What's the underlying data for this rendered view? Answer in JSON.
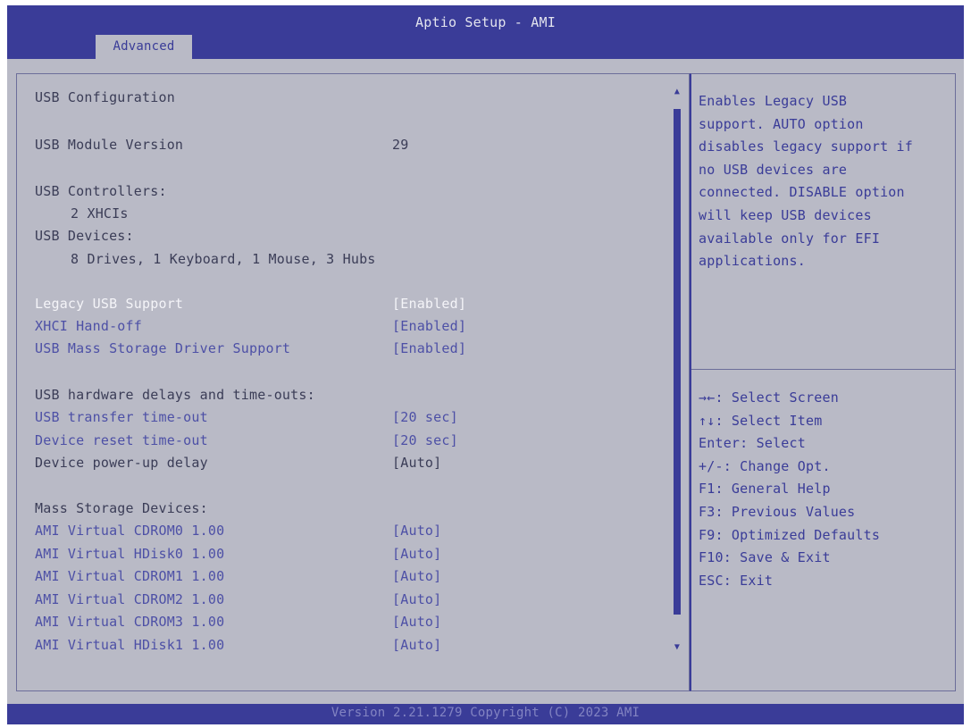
{
  "header": {
    "title": "Aptio Setup - AMI",
    "tab": "Advanced"
  },
  "main": {
    "section_title": "USB Configuration",
    "module_version": {
      "label": "USB Module Version",
      "value": "29"
    },
    "controllers_label": "USB Controllers:",
    "controllers_value": "2 XHCIs",
    "devices_label": "USB Devices:",
    "devices_value": "8 Drives, 1 Keyboard, 1 Mouse, 3 Hubs",
    "options": [
      {
        "label": "Legacy USB Support",
        "value": "[Enabled]"
      },
      {
        "label": "XHCI Hand-off",
        "value": "[Enabled]"
      },
      {
        "label": "USB Mass Storage Driver Support",
        "value": "[Enabled]"
      }
    ],
    "delays_title": "USB hardware delays and time-outs:",
    "delays": [
      {
        "label": "USB transfer time-out",
        "value": "[20 sec]"
      },
      {
        "label": "Device reset time-out",
        "value": "[20 sec]"
      },
      {
        "label": "Device power-up delay",
        "value": "[Auto]"
      }
    ],
    "mass_title": "Mass Storage Devices:",
    "mass_devices": [
      {
        "label": "AMI Virtual CDROM0 1.00",
        "value": "[Auto]"
      },
      {
        "label": "AMI Virtual HDisk0 1.00",
        "value": "[Auto]"
      },
      {
        "label": "AMI Virtual CDROM1 1.00",
        "value": "[Auto]"
      },
      {
        "label": "AMI Virtual CDROM2 1.00",
        "value": "[Auto]"
      },
      {
        "label": "AMI Virtual CDROM3 1.00",
        "value": "[Auto]"
      },
      {
        "label": "AMI Virtual HDisk1 1.00",
        "value": "[Auto]"
      }
    ]
  },
  "help": {
    "text": "Enables Legacy USB\nsupport. AUTO option\ndisables legacy support if\nno USB devices are\nconnected. DISABLE option\nwill keep USB devices\navailable only for EFI\napplications."
  },
  "keys": [
    "→←: Select Screen",
    "↑↓: Select Item",
    "Enter: Select",
    "+/-: Change Opt.",
    "F1: General Help",
    "F3: Previous Values",
    "F9: Optimized Defaults",
    "F10: Save & Exit",
    "ESC: Exit"
  ],
  "footer": {
    "text": "Version 2.21.1279 Copyright (C) 2023 AMI"
  },
  "scrollbar": {
    "up_icon": "▲",
    "down_icon": "▼"
  },
  "colors": {
    "bar": "#3a3c98",
    "panel": "#b9bac6",
    "option": "#4d50a6",
    "selected": "#f4f4f8"
  }
}
